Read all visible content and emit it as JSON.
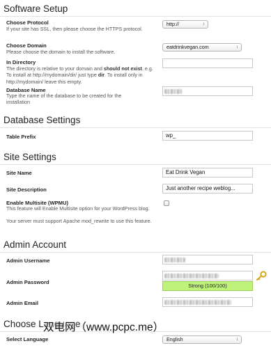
{
  "software_setup": {
    "title": "Software Setup",
    "protocol": {
      "label": "Choose Protocol",
      "desc": "If your site has SSL, then please choose the HTTPS protocol.",
      "value": "http://"
    },
    "domain": {
      "label": "Choose Domain",
      "desc": "Please choose the domain to install the software.",
      "value": "eatdrinkvegan.com"
    },
    "directory": {
      "label": "In Directory",
      "desc_1": "The directory is relative to your domain and ",
      "desc_2": "should not exist",
      "desc_3": ". e.g. To install at http://mydomain/dir/ just type ",
      "desc_4": "dir",
      "desc_5": ". To install only in http://mydomain/ leave this empty.",
      "value": ""
    },
    "database_name": {
      "label": "Database Name",
      "desc": "Type the name of the database to be created for the installation"
    }
  },
  "database_settings": {
    "title": "Database Settings",
    "table_prefix": {
      "label": "Table Prefix",
      "value": "wp_"
    }
  },
  "site_settings": {
    "title": "Site Settings",
    "site_name": {
      "label": "Site Name",
      "value": "Eat Drink Vegan"
    },
    "site_description": {
      "label": "Site Description",
      "value": "Just another recipe weblog..."
    },
    "multisite": {
      "label": "Enable Multisite (WPMU)",
      "desc": "This feature will Enable Multisite option for your WordPress blog.",
      "desc_2": "Your server must support Apache mod_rewrite to use this feature.",
      "checked": false
    }
  },
  "admin_account": {
    "title": "Admin Account",
    "username": {
      "label": "Admin Username"
    },
    "password": {
      "label": "Admin Password",
      "strength": "Strong (100/100)",
      "strength_color": "#bff27a"
    },
    "email": {
      "label": "Admin Email"
    }
  },
  "choose_language": {
    "title": "Choose Language",
    "select_language": {
      "label": "Select Language",
      "value": "English"
    }
  },
  "watermark": "双电网（www.pcpc.me）",
  "icons": {
    "select_arrow": "↕",
    "key": "key-icon"
  }
}
